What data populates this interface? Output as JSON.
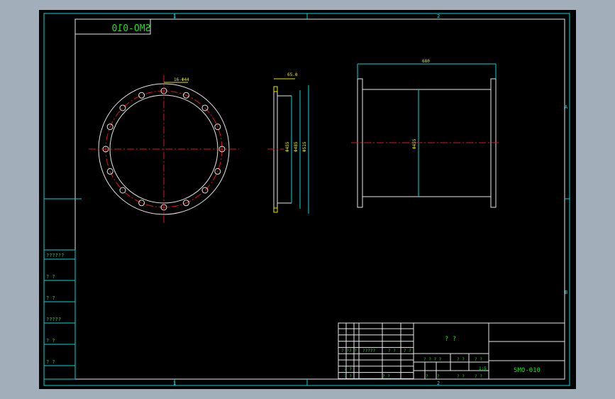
{
  "drawing": {
    "code_mirrored": "SMO-010",
    "code": "SMO-010",
    "tb_title": "? ?",
    "scale": "1:5",
    "zone_top_1": "1",
    "zone_top_2": "2",
    "zone_bottom_1": "1",
    "zone_bottom_2": "2",
    "zone_right_a": "A",
    "zone_right_b": "B"
  },
  "dims": {
    "bolt": "16-Φ44",
    "thick": "65.0",
    "d_inner": "Φ455",
    "d_mid": "Φ485",
    "d_outer": "Φ515",
    "length": "680",
    "body_d": "Φ455"
  },
  "side_labels": [
    "??????",
    "? ?",
    "? ?",
    "?????",
    "? ?",
    "? ?"
  ],
  "title_block": {
    "r1": [
      "? ?",
      "? ?",
      "?????",
      "? ?",
      "? ?"
    ],
    "r2": [
      "? ? ? ?",
      "? ?",
      "? ?"
    ],
    "r3": [
      "? ?",
      "? ?"
    ],
    "r4": [
      "? ?",
      "? ?",
      "?",
      "?",
      "? ?",
      "? ?"
    ]
  },
  "colors": {
    "frame": "#00d8d8",
    "geometry": "#e8e8e8",
    "center": "#d81818",
    "dimension": "#e8e800",
    "text": "#20e020"
  }
}
